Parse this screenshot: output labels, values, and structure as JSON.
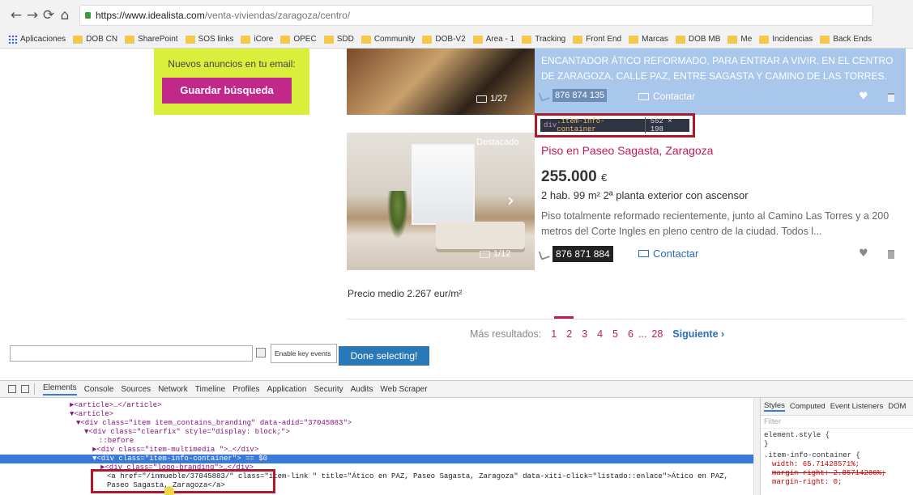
{
  "browser": {
    "url_host": "https://www.idealista.com",
    "url_path": "/venta-viviendas/zaragoza/centro/",
    "apps_label": "Aplicaciones",
    "bookmarks": [
      "DOB CN",
      "SharePoint",
      "SOS links",
      "iCore",
      "OPEC",
      "SDD",
      "Community",
      "DOB-V2",
      "Area - 1",
      "Tracking",
      "Front End",
      "Marcas",
      "DOB MB",
      "Me",
      "Incidencias",
      "Back Ends"
    ]
  },
  "save_search": {
    "text": "Nuevos anuncios en tu email:",
    "button": "Guardar búsqueda"
  },
  "listing1": {
    "description": "ENCANTADOR ÁTICO REFORMADO, PARA ENTRAR A VIVIR, EN EL CENTRO DE ZARAGOZA, CALLE PAZ, ENTRE SAGASTA Y CAMINO DE LAS TORRES.",
    "phone": "876 874 135",
    "contact": "Contactar",
    "photo_count": "1/27"
  },
  "tooltip": {
    "tag": "div",
    "cls": ".item-info-container",
    "size": "552 × 198"
  },
  "listing2": {
    "badge": "Destacado",
    "title": "Piso en Paseo Sagasta, Zaragoza",
    "price": "255.000",
    "currency": "€",
    "details": "2 hab.  99 m²  2ª planta exterior con ascensor",
    "description": "Piso totalmente reformado recientemente, junto al Camino Las Torres y a 200 metros del Corte Ingles en pleno centro de la ciudad. Todos l...",
    "phone": "876 871 884",
    "contact": "Contactar",
    "photo_count": "1/12"
  },
  "avg_price": "Precio medio 2.267 eur/m²",
  "pagination": {
    "label": "Más resultados:",
    "pages": [
      "1",
      "2",
      "3",
      "4",
      "5",
      "6",
      "...",
      "28"
    ],
    "next": "Siguiente ›"
  },
  "selector": {
    "input_placeholder": "",
    "checkbox_label": "Enable key events",
    "done_button": "Done selecting!"
  },
  "devtools": {
    "tabs": [
      "Elements",
      "Console",
      "Sources",
      "Network",
      "Timeline",
      "Profiles",
      "Application",
      "Security",
      "Audits",
      "Web Scraper"
    ],
    "lines": [
      "►<article>…</article>",
      "▼<article>",
      "▼<div class=\"item item_contains_branding\" data-adid=\"37045883\">",
      "▼<div class=\"clearfix\" style=\"display: block;\">",
      "::before",
      "►<div class=\"item-multimedia \">…</div>",
      "▼<div class=\"item-info-container\"> == $0",
      "►<div class=\"logo-branding\">…</div>",
      "<a href=\"/inmueble/37045883/\" class=\"item-link \" title=\"Ático en PAZ, Paseo Sagasta, Zaragoza\" data-xiti-click=\"listado::enlace\">Ático en PAZ,",
      "Paseo Sagasta, Zaragoza</a>"
    ],
    "styles_tabs": [
      "Styles",
      "Computed",
      "Event Listeners",
      "DOM"
    ],
    "filter": "Filter",
    "rules": [
      "element.style {",
      "}",
      ".item-info-container {",
      "width: 65.71428571%;",
      "margin-right: 2.85714286%;",
      "margin-right: 0;"
    ]
  }
}
